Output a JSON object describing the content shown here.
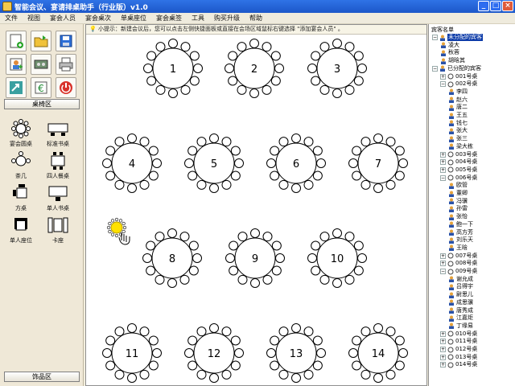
{
  "window": {
    "title": "智能会议、宴请排桌助手（行业版）v1.0"
  },
  "menu": [
    "文件",
    "视图",
    "宴会人员",
    "宴会桌次",
    "单桌座位",
    "宴会桌签",
    "工具",
    "购买升级",
    "帮助"
  ],
  "left_panel": {
    "desk_header": "桌椅区",
    "deco_header": "饰品区",
    "items": [
      "宴会圆桌",
      "标准书桌",
      "茶几",
      "四人餐桌",
      "方桌",
      "单人书桌",
      "单人座位",
      "卡座"
    ]
  },
  "hint": "小提示：新建会议后，您可以点击左侧快捷面板或直接在会场区域鼠标右键选择 \"添加宴会人员\" 。",
  "tables": [
    "1",
    "2",
    "3",
    "4",
    "5",
    "6",
    "7",
    "8",
    "9",
    "10",
    "11",
    "12",
    "13",
    "14"
  ],
  "right_panel": {
    "title": "宾客名单",
    "tree": [
      {
        "label": "未分配的宾客",
        "level": 0,
        "highlight": true,
        "type": "root"
      },
      {
        "label": "凌大",
        "level": 1,
        "type": "person"
      },
      {
        "label": "秋蓉",
        "level": 1,
        "type": "person"
      },
      {
        "label": "胡晗其",
        "level": 1,
        "type": "person"
      },
      {
        "label": "已分配的宾客",
        "level": 0,
        "type": "root"
      },
      {
        "label": "001号桌",
        "level": 1,
        "type": "table"
      },
      {
        "label": "002号桌",
        "level": 1,
        "type": "table"
      },
      {
        "label": "李四",
        "level": 2,
        "type": "person"
      },
      {
        "label": "赵六",
        "level": 2,
        "type": "person"
      },
      {
        "label": "唐二",
        "level": 2,
        "type": "person"
      },
      {
        "label": "王五",
        "level": 2,
        "type": "person"
      },
      {
        "label": "钱七",
        "level": 2,
        "type": "person"
      },
      {
        "label": "张大",
        "level": 2,
        "type": "person"
      },
      {
        "label": "张三",
        "level": 2,
        "type": "person"
      },
      {
        "label": "梁大栋",
        "level": 2,
        "type": "person"
      },
      {
        "label": "003号桌",
        "level": 1,
        "type": "table"
      },
      {
        "label": "004号桌",
        "level": 1,
        "type": "table"
      },
      {
        "label": "005号桌",
        "level": 1,
        "type": "table"
      },
      {
        "label": "006号桌",
        "level": 1,
        "type": "table"
      },
      {
        "label": "欧管",
        "level": 2,
        "type": "person"
      },
      {
        "label": "董卿",
        "level": 2,
        "type": "person"
      },
      {
        "label": "冯骥",
        "level": 2,
        "type": "person"
      },
      {
        "label": "孙雷",
        "level": 2,
        "type": "person"
      },
      {
        "label": "张怡",
        "level": 2,
        "type": "person"
      },
      {
        "label": "鲍一下",
        "level": 2,
        "type": "person"
      },
      {
        "label": "高方芳",
        "level": 2,
        "type": "person"
      },
      {
        "label": "刘乐天",
        "level": 2,
        "type": "person"
      },
      {
        "label": "王晗",
        "level": 2,
        "type": "person"
      },
      {
        "label": "007号桌",
        "level": 1,
        "type": "table"
      },
      {
        "label": "008号桌",
        "level": 1,
        "type": "table"
      },
      {
        "label": "009号桌",
        "level": 1,
        "type": "table"
      },
      {
        "label": "谢允成",
        "level": 2,
        "type": "person"
      },
      {
        "label": "吕得宇",
        "level": 2,
        "type": "person"
      },
      {
        "label": "尉思儿",
        "level": 2,
        "type": "person"
      },
      {
        "label": "成思骥",
        "level": 2,
        "type": "person"
      },
      {
        "label": "唐秀成",
        "level": 2,
        "type": "person"
      },
      {
        "label": "江嘉炬",
        "level": 2,
        "type": "person"
      },
      {
        "label": "丁缘易",
        "level": 2,
        "type": "person"
      },
      {
        "label": "010号桌",
        "level": 1,
        "type": "table"
      },
      {
        "label": "011号桌",
        "level": 1,
        "type": "table"
      },
      {
        "label": "012号桌",
        "level": 1,
        "type": "table"
      },
      {
        "label": "013号桌",
        "level": 1,
        "type": "table"
      },
      {
        "label": "014号桌",
        "level": 1,
        "type": "table"
      }
    ]
  },
  "colors": {
    "titlebar": "#1c57c9",
    "highlight": "#0b3aa8",
    "seat_active": "#ffe100",
    "panel_bg": "#efe8d7"
  }
}
